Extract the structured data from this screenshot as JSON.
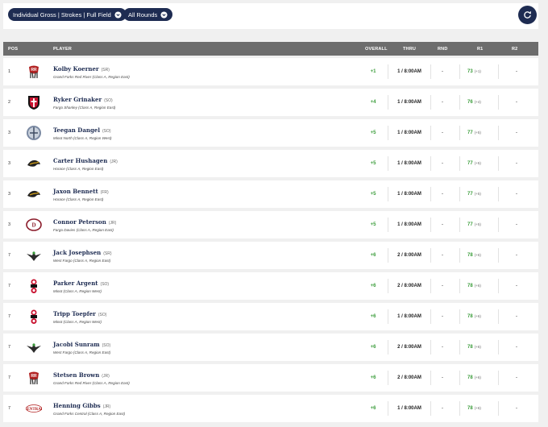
{
  "filters": {
    "field_filter": "Individual Gross | Strokes | Full Field",
    "round_filter": "All Rounds"
  },
  "columns": {
    "pos": "POS",
    "player": "PLAYER",
    "overall": "OVERALL",
    "thru": "THRU",
    "rnd": "RND",
    "r1": "R1",
    "r2": "R2"
  },
  "players": [
    {
      "pos": "1",
      "name": "Kolby Koerner",
      "year": "(SR)",
      "school": "Grand Forks Red River (Class A, Region East)",
      "overall": "+1",
      "thru": "1 / 8:00AM",
      "rnd": "-",
      "r1": "73",
      "r1_rel": "(+1)",
      "r2": "-",
      "logo": "red-river-logo"
    },
    {
      "pos": "2",
      "name": "Ryker Grinaker",
      "year": "(SO)",
      "school": "Fargo Shanley (Class A, Region East)",
      "overall": "+4",
      "thru": "1 / 8:00AM",
      "rnd": "-",
      "r1": "76",
      "r1_rel": "(+4)",
      "r2": "-",
      "logo": "shanley-logo"
    },
    {
      "pos": "3",
      "name": "Teegan Dangel",
      "year": "(SO)",
      "school": "Minot North (Class A, Region West)",
      "overall": "+5",
      "thru": "1 / 8:00AM",
      "rnd": "-",
      "r1": "77",
      "r1_rel": "(+5)",
      "r2": "-",
      "logo": "minot-north-logo"
    },
    {
      "pos": "3",
      "name": "Carter Hushagen",
      "year": "(JR)",
      "school": "Horace (Class A, Region East)",
      "overall": "+5",
      "thru": "1 / 8:00AM",
      "rnd": "-",
      "r1": "77",
      "r1_rel": "(+5)",
      "r2": "-",
      "logo": "horace-logo"
    },
    {
      "pos": "3",
      "name": "Jaxon Bennett",
      "year": "(FR)",
      "school": "Horace (Class A, Region East)",
      "overall": "+5",
      "thru": "1 / 8:00AM",
      "rnd": "-",
      "r1": "77",
      "r1_rel": "(+5)",
      "r2": "-",
      "logo": "horace-logo"
    },
    {
      "pos": "3",
      "name": "Connor Peterson",
      "year": "(JR)",
      "school": "Fargo Davies (Class A, Region East)",
      "overall": "+5",
      "thru": "1 / 8:00AM",
      "rnd": "-",
      "r1": "77",
      "r1_rel": "(+5)",
      "r2": "-",
      "logo": "davies-logo"
    },
    {
      "pos": "7",
      "name": "Jack Josephsen",
      "year": "(SR)",
      "school": "West Fargo (Class A, Region East)",
      "overall": "+6",
      "thru": "2 / 8:00AM",
      "rnd": "-",
      "r1": "78",
      "r1_rel": "(+6)",
      "r2": "-",
      "logo": "west-fargo-logo"
    },
    {
      "pos": "7",
      "name": "Parker Argent",
      "year": "(SO)",
      "school": "Minot (Class A, Region West)",
      "overall": "+6",
      "thru": "2 / 8:00AM",
      "rnd": "-",
      "r1": "78",
      "r1_rel": "(+6)",
      "r2": "-",
      "logo": "minot-logo"
    },
    {
      "pos": "7",
      "name": "Tripp Toepfer",
      "year": "(SO)",
      "school": "Minot (Class A, Region West)",
      "overall": "+6",
      "thru": "1 / 8:00AM",
      "rnd": "-",
      "r1": "78",
      "r1_rel": "(+6)",
      "r2": "-",
      "logo": "minot-logo"
    },
    {
      "pos": "7",
      "name": "Jacobi Sunram",
      "year": "(SO)",
      "school": "West Fargo (Class A, Region East)",
      "overall": "+6",
      "thru": "2 / 8:00AM",
      "rnd": "-",
      "r1": "78",
      "r1_rel": "(+6)",
      "r2": "-",
      "logo": "west-fargo-logo"
    },
    {
      "pos": "7",
      "name": "Stetsen Brown",
      "year": "(JR)",
      "school": "Grand Forks Red River (Class A, Region East)",
      "overall": "+6",
      "thru": "2 / 8:00AM",
      "rnd": "-",
      "r1": "78",
      "r1_rel": "(+6)",
      "r2": "-",
      "logo": "red-river-logo"
    },
    {
      "pos": "7",
      "name": "Henning Gibbs",
      "year": "(JR)",
      "school": "Grand Forks Central (Class A, Region East)",
      "overall": "+6",
      "thru": "1 / 8:00AM",
      "rnd": "-",
      "r1": "78",
      "r1_rel": "(+6)",
      "r2": "-",
      "logo": "central-logo"
    }
  ],
  "colors": {
    "navy": "#1e2c52",
    "header_gray": "#6d6d6d",
    "score_green": "#3a9c3a"
  }
}
